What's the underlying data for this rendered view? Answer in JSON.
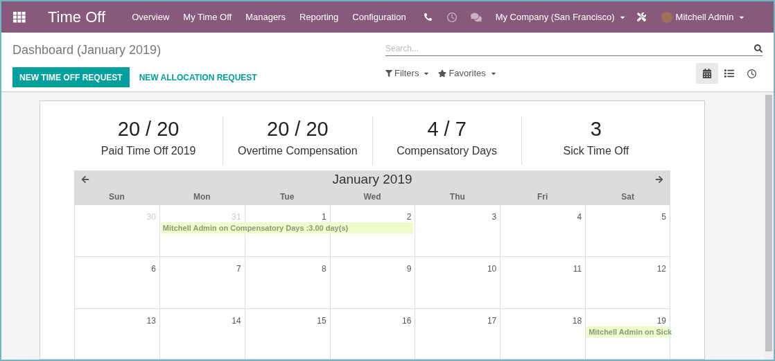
{
  "navbar": {
    "app_title": "Time Off",
    "menu": [
      "Overview",
      "My Time Off",
      "Managers",
      "Reporting",
      "Configuration"
    ],
    "company": "My Company (San Francisco)",
    "user": "Mitchell Admin"
  },
  "control_panel": {
    "breadcrumb": "Dashboard (January 2019)",
    "buttons": [
      {
        "label": "NEW TIME OFF REQUEST",
        "kind": "primary"
      },
      {
        "label": "NEW ALLOCATION REQUEST",
        "kind": "link"
      }
    ],
    "search": {
      "placeholder": "Search..."
    },
    "filters": [
      {
        "label": "Filters",
        "kind": "filter"
      },
      {
        "label": "Favorites",
        "kind": "star"
      }
    ],
    "views": [
      {
        "kind": "calendar",
        "selected": true
      },
      {
        "kind": "list",
        "selected": false
      },
      {
        "kind": "activity",
        "selected": false
      }
    ]
  },
  "summary": [
    {
      "value": "20 / 20",
      "label": "Paid Time Off 2019"
    },
    {
      "value": "20 / 20",
      "label": "Overtime Compensation"
    },
    {
      "value": "4 / 7",
      "label": "Compensatory Days"
    },
    {
      "value": "3",
      "label": "Sick Time Off"
    }
  ],
  "calendar": {
    "title": "January 2019",
    "weekdays": [
      "Sun",
      "Mon",
      "Tue",
      "Wed",
      "Thu",
      "Fri",
      "Sat"
    ],
    "weeks": [
      {
        "days": [
          {
            "label": "30",
            "other_month": true
          },
          {
            "label": "31",
            "other_month": true,
            "event": "Mitchell Admin on Compensatory Days :3.00 day(s)"
          },
          {
            "label": "1",
            "other_month": false,
            "event_continues": true
          },
          {
            "label": "2",
            "other_month": false,
            "event_continues": true
          },
          {
            "label": "3",
            "other_month": false
          },
          {
            "label": "4",
            "other_month": false
          },
          {
            "label": "5",
            "other_month": false
          }
        ]
      },
      {
        "days": [
          {
            "label": "6",
            "other_month": false
          },
          {
            "label": "7",
            "other_month": false
          },
          {
            "label": "8",
            "other_month": false
          },
          {
            "label": "9",
            "other_month": false
          },
          {
            "label": "10",
            "other_month": false
          },
          {
            "label": "11",
            "other_month": false
          },
          {
            "label": "12",
            "other_month": false
          }
        ]
      },
      {
        "days": [
          {
            "label": "13",
            "other_month": false
          },
          {
            "label": "14",
            "other_month": false
          },
          {
            "label": "15",
            "other_month": false
          },
          {
            "label": "16",
            "other_month": false
          },
          {
            "label": "17",
            "other_month": false
          },
          {
            "label": "18",
            "other_month": false
          },
          {
            "label": "19",
            "other_month": false,
            "event": "Mitchell Admin on Sick"
          }
        ]
      }
    ]
  }
}
